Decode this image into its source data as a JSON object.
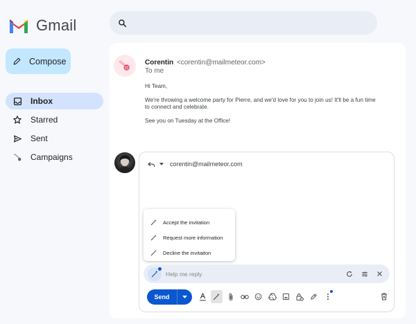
{
  "app": {
    "name": "Gmail"
  },
  "search": {
    "placeholder": ""
  },
  "compose": {
    "label": "Compose"
  },
  "nav": {
    "items": [
      {
        "label": "Inbox",
        "icon": "inbox-icon",
        "active": true
      },
      {
        "label": "Starred",
        "icon": "star-icon",
        "active": false
      },
      {
        "label": "Sent",
        "icon": "send-icon",
        "active": false
      },
      {
        "label": "Campaigns",
        "icon": "comet-icon",
        "active": false
      }
    ]
  },
  "email": {
    "sender_name": "Corentin",
    "sender_email": "<corentin@mailmeteor.com>",
    "to": "To me",
    "greeting": "Hi Team,",
    "paragraph1": "We're throwing a welcome party for Pierre, and we'd love for you to join us! It'll be a fun time to connect and celebrate.",
    "paragraph2": "See you on Tuesday at the Office!"
  },
  "reply": {
    "recipient": "corentin@mailmeteor.com",
    "help_placeholder": "Help me reply",
    "send_label": "Send"
  },
  "suggestions": [
    {
      "label": "Accept the invitation"
    },
    {
      "label": "Request more information"
    },
    {
      "label": "Decline the invitaiton"
    }
  ],
  "colors": {
    "accent": "#0b57d0",
    "compose_bg": "#c2e7ff",
    "nav_active_bg": "#d3e3fd",
    "page_bg": "#f6f8fc"
  }
}
